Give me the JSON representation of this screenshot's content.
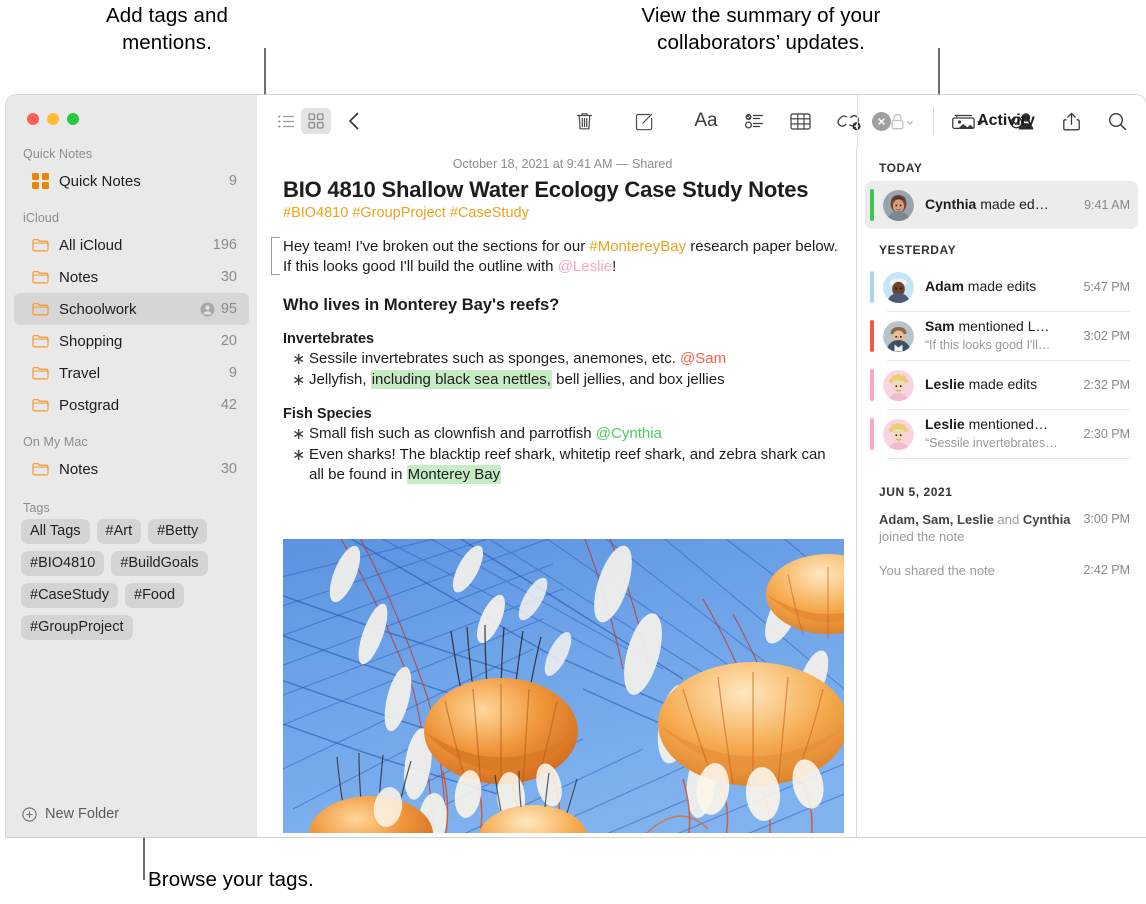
{
  "callouts": [
    {
      "id": "tags-mentions",
      "text": "Add tags and\nmentions."
    },
    {
      "id": "activity-summary",
      "text": "View the summary of your\ncollaborators’ updates."
    },
    {
      "id": "browse-tags",
      "text": "Browse your tags."
    }
  ],
  "sidebar": {
    "sections": [
      {
        "title": "Quick Notes",
        "items": [
          {
            "label": "Quick Notes",
            "count": "9",
            "icon": "quick-notes-icon",
            "selected": false,
            "shared": false
          }
        ]
      },
      {
        "title": "iCloud",
        "items": [
          {
            "label": "All iCloud",
            "count": "196",
            "icon": "folder-icon",
            "selected": false,
            "shared": false
          },
          {
            "label": "Notes",
            "count": "30",
            "icon": "folder-icon",
            "selected": false,
            "shared": false
          },
          {
            "label": "Schoolwork",
            "count": "95",
            "icon": "folder-icon",
            "selected": true,
            "shared": true
          },
          {
            "label": "Shopping",
            "count": "20",
            "icon": "folder-icon",
            "selected": false,
            "shared": false
          },
          {
            "label": "Travel",
            "count": "9",
            "icon": "folder-icon",
            "selected": false,
            "shared": false
          },
          {
            "label": "Postgrad",
            "count": "42",
            "icon": "folder-icon",
            "selected": false,
            "shared": false
          }
        ]
      },
      {
        "title": "On My Mac",
        "items": [
          {
            "label": "Notes",
            "count": "30",
            "icon": "folder-icon",
            "selected": false,
            "shared": false
          }
        ]
      }
    ],
    "tags_title": "Tags",
    "tags": [
      "All Tags",
      "#Art",
      "#Betty",
      "#BIO4810",
      "#BuildGoals",
      "#CaseStudy",
      "#Food",
      "#GroupProject"
    ],
    "new_folder_label": "New Folder"
  },
  "toolbar": {
    "left": [
      {
        "name": "list-view-icon",
        "active": false
      },
      {
        "name": "gallery-view-icon",
        "active": true
      },
      {
        "name": "back-chevron-icon",
        "active": false
      }
    ],
    "center": [
      {
        "name": "trash-icon"
      },
      {
        "name": "compose-icon"
      },
      {
        "name": "format-icon",
        "label": "Aa"
      },
      {
        "name": "checklist-icon"
      },
      {
        "name": "table-icon"
      },
      {
        "name": "link-icon"
      },
      {
        "name": "lock-icon"
      }
    ],
    "right": [
      {
        "name": "media-icon"
      },
      {
        "name": "collaborate-icon"
      },
      {
        "name": "share-icon"
      },
      {
        "name": "search-icon"
      }
    ]
  },
  "note": {
    "date": "October 18, 2021 at 9:41 AM — Shared",
    "title": "BIO 4810 Shallow Water Ecology Case Study Notes",
    "tags": "#BIO4810 #GroupProject #CaseStudy",
    "intro": {
      "p1": "Hey team! I've broken out the sections for our ",
      "tag": "#MontereyBay",
      "p2": " research paper below. If this looks good I'll build the outline with ",
      "mention": "@Leslie",
      "p3": "!"
    },
    "heading": "Who lives in Monterey Bay's reefs?",
    "sections": [
      {
        "subhead": "Invertebrates",
        "bullets": [
          {
            "parts": [
              {
                "t": "Sessile invertebrates such as sponges, anemones, etc. ",
                "s": "plain"
              },
              {
                "t": "@Sam",
                "s": "mention-red"
              }
            ]
          },
          {
            "parts": [
              {
                "t": "Jellyfish, ",
                "s": "plain"
              },
              {
                "t": "including black sea nettles,",
                "s": "highlight"
              },
              {
                "t": " bell jellies, and box jellies",
                "s": "plain"
              }
            ]
          }
        ]
      },
      {
        "subhead": "Fish Species",
        "bullets": [
          {
            "parts": [
              {
                "t": "Small fish such as clownfish and parrotfish ",
                "s": "plain"
              },
              {
                "t": "@Cynthia",
                "s": "mention-green"
              }
            ]
          },
          {
            "parts": [
              {
                "t": "Even sharks! The blacktip reef shark, whitetip reef shark, and zebra shark can all be found in ",
                "s": "plain"
              },
              {
                "t": "Monterey Bay",
                "s": "highlight"
              }
            ]
          }
        ]
      }
    ],
    "image_name": "jellyfish-photo"
  },
  "activity": {
    "title": "Activity",
    "groups": [
      {
        "day": "TODAY",
        "entries": [
          {
            "name": "Cynthia",
            "action": " made ed…",
            "quote": "",
            "time": "9:41 AM",
            "bar": "#3fc552",
            "avatar": "cynthia",
            "selected": true
          }
        ]
      },
      {
        "day": "YESTERDAY",
        "entries": [
          {
            "name": "Adam",
            "action": " made edits",
            "quote": "",
            "time": "5:47 PM",
            "bar": "#a8d8f0",
            "avatar": "adam",
            "selected": false
          },
          {
            "name": "Sam",
            "action": " mentioned L…",
            "quote": "“If this looks good I'll…",
            "time": "3:02 PM",
            "bar": "#f05a42",
            "avatar": "sam",
            "selected": false
          },
          {
            "name": "Leslie",
            "action": " made edits",
            "quote": "",
            "time": "2:32 PM",
            "bar": "#f7a8c4",
            "avatar": "leslie",
            "selected": false
          },
          {
            "name": "Leslie",
            "action": " mentioned…",
            "quote": "“Sessile invertebrates…",
            "time": "2:30 PM",
            "bar": "#f7a8c4",
            "avatar": "leslie",
            "selected": false
          }
        ]
      }
    ],
    "older_day": "JUN 5, 2021",
    "older": [
      {
        "names": "Adam, Sam, Leslie",
        "mid": " and ",
        "names2": "Cynthia",
        "tail": " joined the note",
        "time": "3:00 PM"
      },
      {
        "names": "",
        "mid": "",
        "names2": "",
        "tail": "You shared the note",
        "time": "2:42 PM"
      }
    ]
  },
  "colors": {
    "accent_orange": "#eba31b",
    "folder_orange": "#f0a030",
    "highlight_green": "#c5ecc5",
    "sidebar_bg": "#e9e9e9"
  }
}
